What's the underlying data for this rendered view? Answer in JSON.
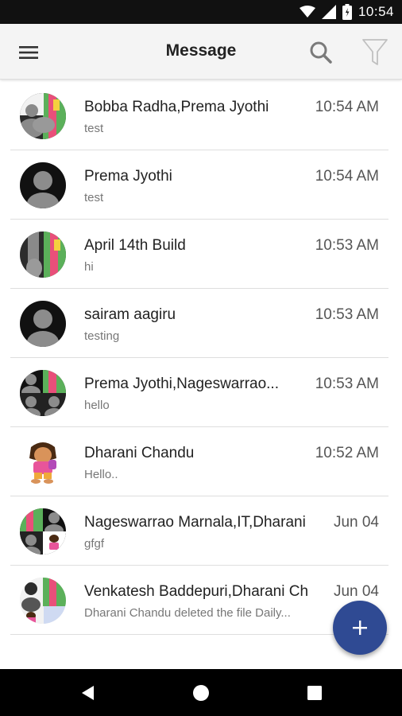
{
  "status_bar": {
    "time": "10:54"
  },
  "app_bar": {
    "title": "Message"
  },
  "conversations": [
    {
      "name": "Bobba Radha,Prema Jyothi",
      "preview": "test",
      "time": "10:54 AM"
    },
    {
      "name": "Prema Jyothi",
      "preview": "test",
      "time": "10:54 AM"
    },
    {
      "name": "April 14th Build",
      "preview": "hi",
      "time": "10:53 AM"
    },
    {
      "name": "sairam aagiru",
      "preview": "testing",
      "time": "10:53 AM"
    },
    {
      "name": "Prema Jyothi,Nageswarrao...",
      "preview": "hello",
      "time": "10:53 AM"
    },
    {
      "name": "Dharani Chandu",
      "preview": "Hello..",
      "time": "10:52 AM"
    },
    {
      "name": "Nageswarrao Marnala,IT,Dharani",
      "preview": "gfgf",
      "time": "Jun 04"
    },
    {
      "name": "Venkatesh Baddepuri,Dharani Ch",
      "preview": "Dharani Chandu  deleted the file  Daily...",
      "time": "Jun 04"
    }
  ],
  "colors": {
    "fab": "#2f4a93",
    "status_bar": "#111111",
    "app_bar": "#f4f4f4"
  }
}
